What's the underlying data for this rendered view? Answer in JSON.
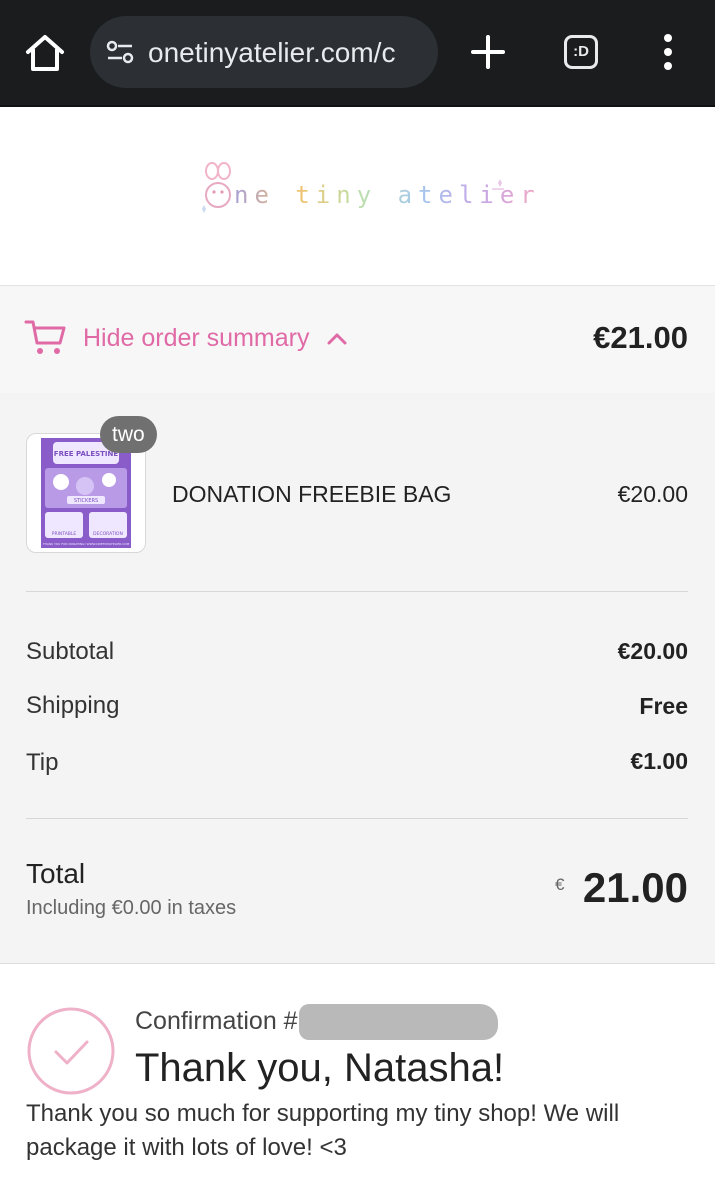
{
  "browser": {
    "url": "onetinyatelier.com/c",
    "tabs_label": ":D"
  },
  "shop": {
    "logo_text": "ne tiny atelier"
  },
  "summary": {
    "toggle_label": "Hide order summary",
    "total": "€21.00",
    "accent_color": "#e06aa6"
  },
  "items": [
    {
      "name": "DONATION FREEBIE BAG",
      "price": "€20.00",
      "quantity_badge": "two",
      "thumbnail": {
        "title": "FREE PALESTINE",
        "subtitle": "STICKERS",
        "footer_left": "PRINTABLE",
        "footer_right": "DECORATION",
        "footer_note": "THANK YOU FOR DONATING! WWW.ONETINYATELIER.COM"
      }
    }
  ],
  "costs": {
    "subtotal_label": "Subtotal",
    "subtotal_value": "€20.00",
    "shipping_label": "Shipping",
    "shipping_value": "Free",
    "tip_label": "Tip",
    "tip_value": "€1.00"
  },
  "total": {
    "label": "Total",
    "taxes": "Including €0.00 in taxes",
    "currency": "€",
    "amount": "21.00"
  },
  "confirmation": {
    "number_label": "Confirmation #",
    "title": "Thank you, Natasha!",
    "message": "Thank you so much for supporting my tiny shop! We will package it with lots of love! <3"
  }
}
